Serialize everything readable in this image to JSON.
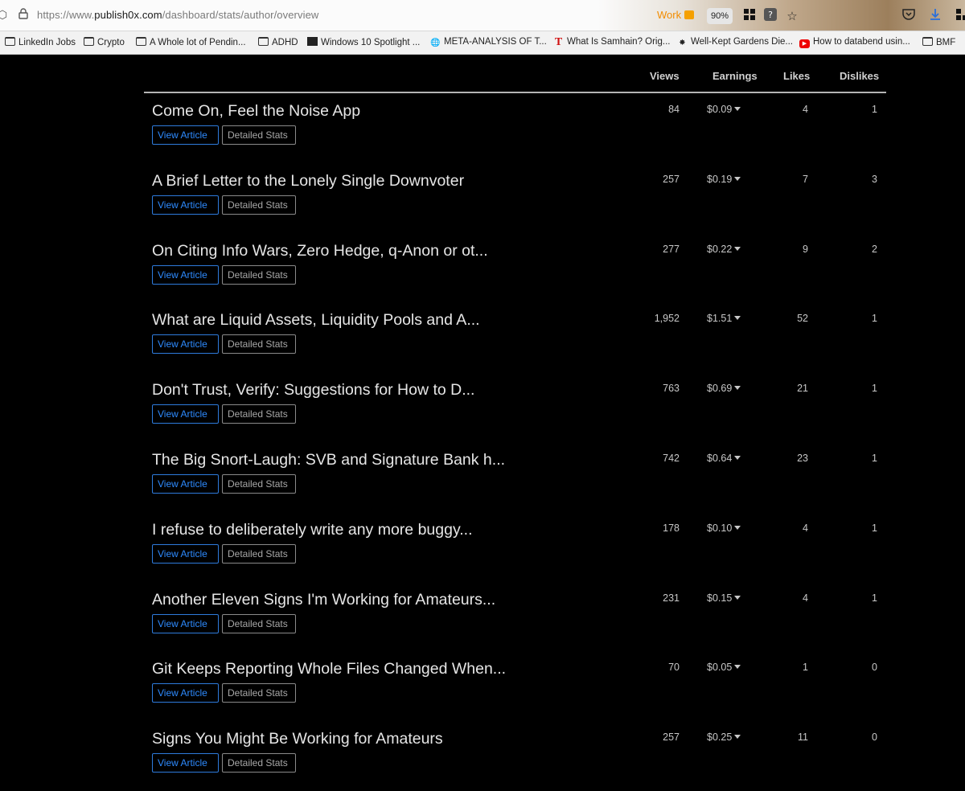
{
  "browser": {
    "url_prefix": "https://www.",
    "url_domain": "publish0x.com",
    "url_path": "/dashboard/stats/author/overview",
    "container_label": "Work",
    "zoom": "90%"
  },
  "bookmarks": [
    {
      "label": "LinkedIn Jobs",
      "icon": "folder-icon"
    },
    {
      "label": "Crypto",
      "icon": "folder-icon"
    },
    {
      "label": "A Whole lot of Pendin...",
      "icon": "folder-icon"
    },
    {
      "label": "ADHD",
      "icon": "folder-icon"
    },
    {
      "label": "Windows 10 Spotlight ...",
      "icon": "spotlight-icon"
    },
    {
      "label": "META-ANALYSIS OF T...",
      "icon": "globe-icon"
    },
    {
      "label": "What Is Samhain? Orig...",
      "icon": "t-logo-icon"
    },
    {
      "label": "Well-Kept Gardens Die...",
      "icon": "star-burst-icon"
    },
    {
      "label": "How to databend usin...",
      "icon": "youtube-icon"
    },
    {
      "label": "BMF",
      "icon": "folder-icon"
    }
  ],
  "table": {
    "headers": {
      "views": "Views",
      "earnings": "Earnings",
      "likes": "Likes",
      "dislikes": "Dislikes"
    },
    "view_button_label": "View Article",
    "stats_button_label": "Detailed Stats",
    "rows": [
      {
        "title": "Come On, Feel the Noise App",
        "views": "84",
        "earnings": "$0.09",
        "likes": "4",
        "dislikes": "1"
      },
      {
        "title": "A Brief Letter to the Lonely Single Downvoter",
        "views": "257",
        "earnings": "$0.19",
        "likes": "7",
        "dislikes": "3"
      },
      {
        "title": "On Citing Info Wars, Zero Hedge, q-Anon or ot...",
        "views": "277",
        "earnings": "$0.22",
        "likes": "9",
        "dislikes": "2"
      },
      {
        "title": "What are Liquid Assets, Liquidity Pools and A...",
        "views": "1,952",
        "earnings": "$1.51",
        "likes": "52",
        "dislikes": "1"
      },
      {
        "title": "Don't Trust, Verify: Suggestions for How to D...",
        "views": "763",
        "earnings": "$0.69",
        "likes": "21",
        "dislikes": "1"
      },
      {
        "title": "The Big Snort-Laugh: SVB and Signature Bank h...",
        "views": "742",
        "earnings": "$0.64",
        "likes": "23",
        "dislikes": "1"
      },
      {
        "title": "I refuse to deliberately write any more buggy...",
        "views": "178",
        "earnings": "$0.10",
        "likes": "4",
        "dislikes": "1"
      },
      {
        "title": "Another Eleven Signs I'm Working for Amateurs...",
        "views": "231",
        "earnings": "$0.15",
        "likes": "4",
        "dislikes": "1"
      },
      {
        "title": "Git Keeps Reporting Whole Files Changed When...",
        "views": "70",
        "earnings": "$0.05",
        "likes": "1",
        "dislikes": "0"
      },
      {
        "title": "Signs You Might Be Working for Amateurs",
        "views": "257",
        "earnings": "$0.25",
        "likes": "11",
        "dislikes": "0"
      }
    ]
  }
}
